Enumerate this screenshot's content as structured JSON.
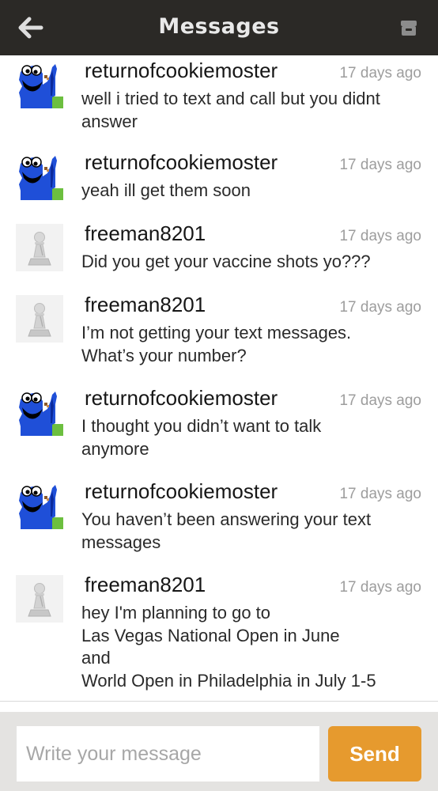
{
  "header": {
    "title": "Messages",
    "back_icon": "arrow-left-icon",
    "archive_icon": "archive-box-icon",
    "background": "#2b2926"
  },
  "messages": [
    {
      "username": "returnofcookiemoster",
      "time": "17 days ago",
      "text": "well i tried to text and call but you didnt\nanswer",
      "avatar": "cookie-monster-avatar"
    },
    {
      "username": "returnofcookiemoster",
      "time": "17 days ago",
      "text": "yeah ill get them soon",
      "avatar": "cookie-monster-avatar"
    },
    {
      "username": "freeman8201",
      "time": "17 days ago",
      "text": "Did you get your vaccine shots yo???",
      "avatar": "pawn-avatar"
    },
    {
      "username": "freeman8201",
      "time": "17 days ago",
      "text": "I’m not getting your text messages.\nWhat’s your number?",
      "avatar": "pawn-avatar"
    },
    {
      "username": "returnofcookiemoster",
      "time": "17 days ago",
      "text": "I thought you didn’t want to talk\nanymore",
      "avatar": "cookie-monster-avatar"
    },
    {
      "username": "returnofcookiemoster",
      "time": "17 days ago",
      "text": "You haven’t been answering your text\nmessages",
      "avatar": "cookie-monster-avatar"
    },
    {
      "username": "freeman8201",
      "time": "17 days ago",
      "text": "hey I'm planning to go to\nLas Vegas National Open in June\nand\nWorld Open in Philadelphia in July 1-5",
      "avatar": "pawn-avatar"
    }
  ],
  "composer": {
    "placeholder": "Write your message",
    "value": "",
    "send_label": "Send",
    "send_color": "#e69a2e"
  }
}
